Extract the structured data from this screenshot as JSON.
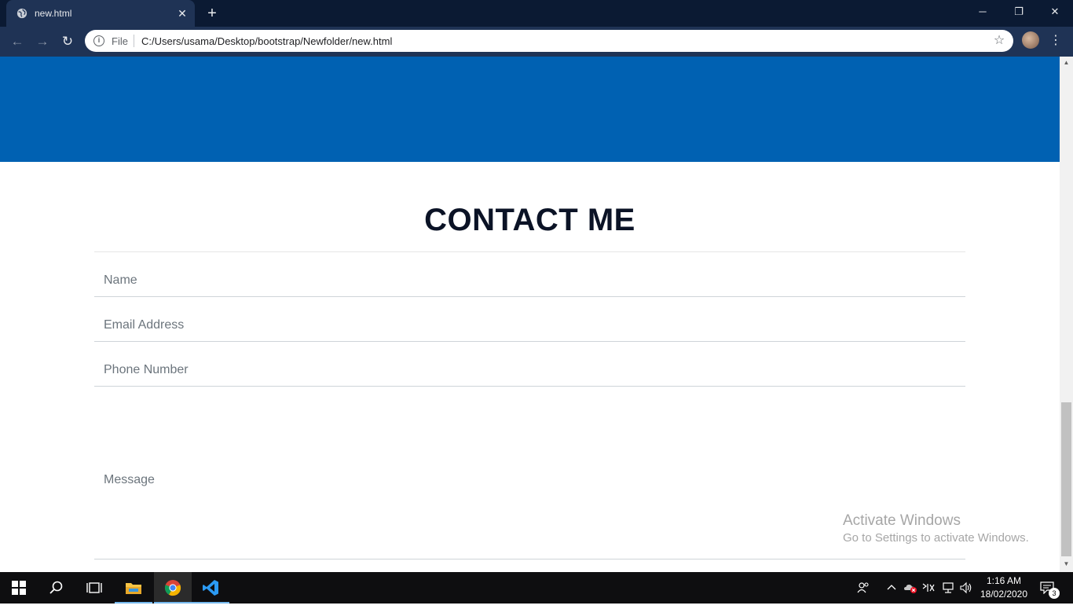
{
  "browser": {
    "tab_title": "new.html",
    "tab_close": "✕",
    "new_tab": "+",
    "window_controls": {
      "minimize": "─",
      "restore": "❐",
      "close": "✕"
    },
    "nav": {
      "back": "←",
      "forward": "→",
      "reload": "↻"
    },
    "omnibox": {
      "info": "i",
      "scheme_label": "File",
      "url": "C:/Users/usama/Desktop/bootstrap/Newfolder/new.html",
      "bookmark": "☆"
    },
    "menu": "⋮"
  },
  "page": {
    "hero_color": "#0061b2",
    "heading": "CONTACT ME",
    "form": {
      "name_placeholder": "Name",
      "email_placeholder": "Email Address",
      "phone_placeholder": "Phone Number",
      "message_placeholder": "Message"
    },
    "watermark": {
      "title": "Activate Windows",
      "subtitle": "Go to Settings to activate Windows."
    }
  },
  "scrollbar": {
    "up": "▲",
    "down": "▼"
  },
  "taskbar": {
    "clock_time": "1:16 AM",
    "clock_date": "18/02/2020",
    "notification_count": "3",
    "icons": [
      "windows-start-icon",
      "search-icon",
      "task-view-icon",
      "file-explorer-icon",
      "chrome-icon",
      "vscode-icon"
    ]
  }
}
